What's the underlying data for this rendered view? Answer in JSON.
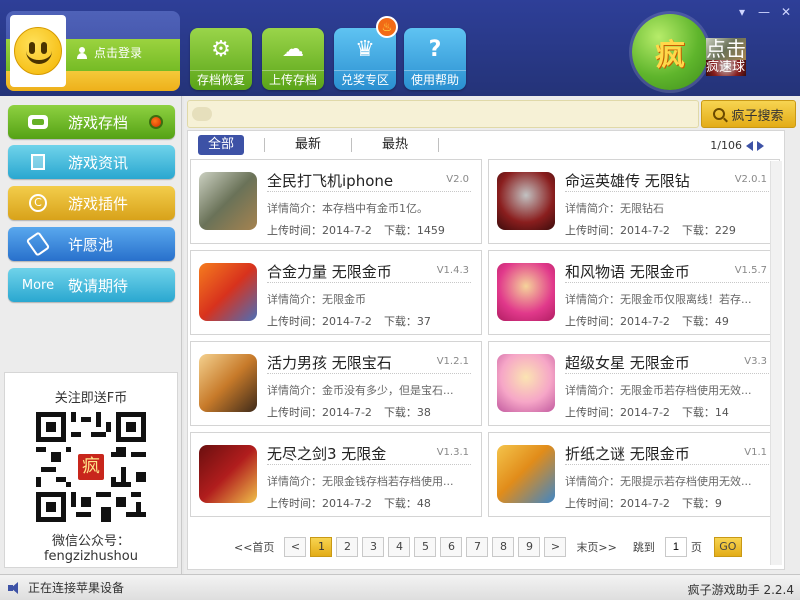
{
  "window": {
    "title": "疯子游戏助手",
    "version": "2.2.4"
  },
  "header": {
    "login_label": "点击登录",
    "buttons": [
      {
        "label": "存档恢复",
        "icon": "gear-icon"
      },
      {
        "label": "上传存档",
        "icon": "cloud-upload-icon"
      },
      {
        "label": "兑奖专区",
        "icon": "trophy-icon"
      },
      {
        "label": "使用帮助",
        "icon": "question-icon"
      }
    ],
    "speedball": {
      "glyph": "疯",
      "line1": "点击",
      "line2": "疯速球"
    }
  },
  "sidebar": {
    "items": [
      {
        "label": "游戏存档",
        "icon": "gamepad-icon"
      },
      {
        "label": "游戏资讯",
        "icon": "documents-icon"
      },
      {
        "label": "游戏插件",
        "icon": "copyright-icon"
      },
      {
        "label": "许愿池",
        "icon": "phone-icon"
      },
      {
        "label": "敬请期待",
        "tag": "More"
      }
    ],
    "qr": {
      "title": "关注即送F币",
      "logo": "疯",
      "caption1": "微信公众号：",
      "caption2": "fengzizhushou"
    }
  },
  "search": {
    "placeholder": "",
    "button_label": "疯子搜索"
  },
  "tabs": [
    {
      "label": "全部",
      "active": true
    },
    {
      "label": "最新",
      "active": false
    },
    {
      "label": "最热",
      "active": false
    }
  ],
  "page_indicator": "1/106",
  "games": [
    {
      "title": "全民打飞机iphone",
      "version": "V2.0",
      "desc": "详情简介：本存档中有金币1亿。",
      "upload": "上传时间：2014-7-2",
      "downloads": "下载：1459"
    },
    {
      "title": "命运英雄传 无限钻",
      "version": "V2.0.1",
      "desc": "详情简介：无限钻石",
      "upload": "上传时间：2014-7-2",
      "downloads": "下载：229"
    },
    {
      "title": "合金力量 无限金币",
      "version": "V1.4.3",
      "desc": "详情简介：无限金币",
      "upload": "上传时间：2014-7-2",
      "downloads": "下载：37"
    },
    {
      "title": "和风物语 无限金币",
      "version": "V1.5.7",
      "desc": "详情简介：无限金币仅限离线！若存...",
      "upload": "上传时间：2014-7-2",
      "downloads": "下载：49"
    },
    {
      "title": "活力男孩 无限宝石",
      "version": "V1.2.1",
      "desc": "详情简介：金币没有多少，但是宝石...",
      "upload": "上传时间：2014-7-2",
      "downloads": "下载：38"
    },
    {
      "title": "超级女星 无限金币",
      "version": "V3.3",
      "desc": "详情简介：无限金币若存档使用无效...",
      "upload": "上传时间：2014-7-2",
      "downloads": "下载：14"
    },
    {
      "title": "无尽之剑3 无限金",
      "version": "V1.3.1",
      "desc": "详情简介：无限金钱存档若存档使用...",
      "upload": "上传时间：2014-7-2",
      "downloads": "下载：48"
    },
    {
      "title": "折纸之谜 无限金币",
      "version": "V1.1",
      "desc": "详情简介：无限提示若存档使用无效...",
      "upload": "上传时间：2014-7-2",
      "downloads": "下载：9"
    }
  ],
  "pagination": {
    "first": "<<首页",
    "prev": "<",
    "pages": [
      "1",
      "2",
      "3",
      "4",
      "5",
      "6",
      "7",
      "8",
      "9"
    ],
    "next": ">",
    "last": "末页>>",
    "jump_label": "跳到",
    "jump_value": "1",
    "page_unit": "页",
    "go": "GO"
  },
  "status": {
    "message": "正在连接苹果设备",
    "app": "疯子游戏助手 2.2.4"
  },
  "colors": {
    "header": "#2e3f98",
    "accent_green": "#6cb51f",
    "accent_yellow": "#e3ac17",
    "accent_blue": "#3d52a6"
  }
}
